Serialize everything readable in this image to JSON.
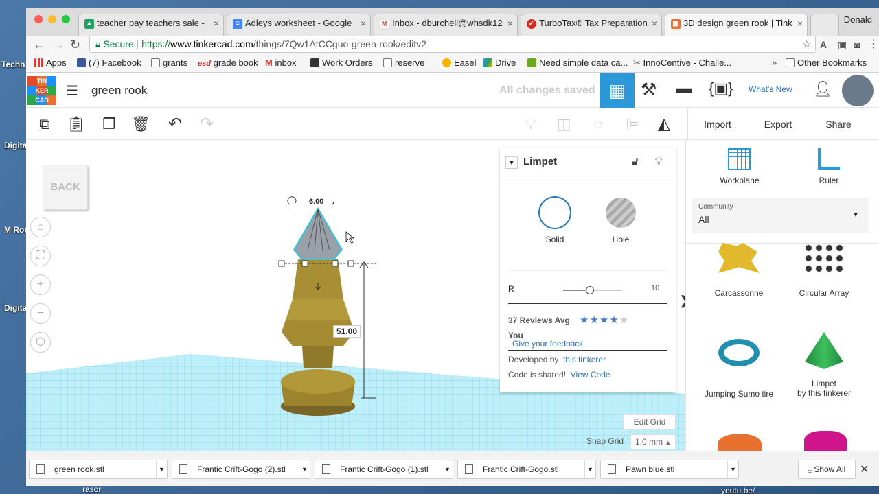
{
  "desktop": {
    "labels": [
      "Techn almanc",
      "Digita ivity",
      "M Roosev",
      "Digita New",
      "rasor",
      "youtu.be/"
    ]
  },
  "browser": {
    "user": "Donald",
    "tabs": [
      {
        "title": "teacher pay teachers sale -",
        "icon": "drive-icon",
        "color": "#1fa463"
      },
      {
        "title": "Adleys worksheet - Google",
        "icon": "docs-icon",
        "color": "#4285f4"
      },
      {
        "title": "Inbox - dburchell@whsdk12",
        "icon": "gmail-icon",
        "color": "#db4437"
      },
      {
        "title": "TurboTax® Tax Preparation",
        "icon": "turbotax-icon",
        "color": "#d52b1e"
      },
      {
        "title": "3D design green rook | Tink",
        "icon": "tinkercad-icon",
        "color": "#e8712f"
      }
    ],
    "address": {
      "secure": "Secure",
      "scheme": "https://",
      "host": "www.tinkercad.com",
      "path": "/things/7Qw1AtCCguo-green-rook/editv2"
    },
    "bookmarks": [
      {
        "label": "Apps",
        "color": "#999"
      },
      {
        "label": "(7) Facebook",
        "color": "#3b5998"
      },
      {
        "label": "grants",
        "color": "#bbb"
      },
      {
        "label": "grade book",
        "color": "#c62828"
      },
      {
        "label": "inbox",
        "color": "#db4437"
      },
      {
        "label": "Work Orders",
        "color": "#333"
      },
      {
        "label": "reserve",
        "color": "#bbb"
      },
      {
        "label": "Easel",
        "color": "#f4b400"
      },
      {
        "label": "Drive",
        "color": "#1fa463"
      },
      {
        "label": "Need simple data ca...",
        "color": "#6aaa1f"
      },
      {
        "label": "InnoCentive - Challe...",
        "color": "#555"
      }
    ],
    "other_bookmarks": "Other Bookmarks",
    "bookmark_prefixes": {
      "grade_book": "esd",
      "inbox": "M"
    }
  },
  "app": {
    "title": "green rook",
    "save_status": "All changes saved",
    "whats_new": "What's New",
    "logo_letters": [
      "TIN",
      "KER",
      "CAD"
    ],
    "actions": {
      "import": "Import",
      "export": "Export",
      "share": "Share"
    },
    "viewcube": "BACK",
    "dims": {
      "top": "6.00",
      "height": "51.00"
    },
    "edit_grid": "Edit Grid",
    "snap_grid_label": "Snap Grid",
    "snap_grid_value": "1.0 mm"
  },
  "shape_panel": {
    "name": "Limpet",
    "solid": "Solid",
    "hole": "Hole",
    "param_label": "R",
    "param_value": "10",
    "param_fraction": 0.45,
    "reviews": "37 Reviews Avg",
    "rating": 4,
    "you": "You",
    "feedback": "Give your feedback",
    "developed_by": "Developed by",
    "developer": "this tinkerer",
    "code_shared": "Code is shared!",
    "view_code": "View Code"
  },
  "library": {
    "workplane": "Workplane",
    "ruler": "Ruler",
    "category_label": "Community",
    "category_value": "All",
    "items": [
      {
        "name": "Carcassonne"
      },
      {
        "name": "Circular Array"
      },
      {
        "name": "Jumping Sumo tire"
      },
      {
        "name": "Limpet",
        "by": "by",
        "author": "this tinkerer"
      }
    ]
  },
  "downloads": {
    "files": [
      "green rook.stl",
      "Frantic Crift-Gogo (2).stl",
      "Frantic Crift-Gogo (1).stl",
      "Frantic Crift-Gogo.stl",
      "Pawn blue.stl"
    ],
    "show_all": "Show All"
  }
}
